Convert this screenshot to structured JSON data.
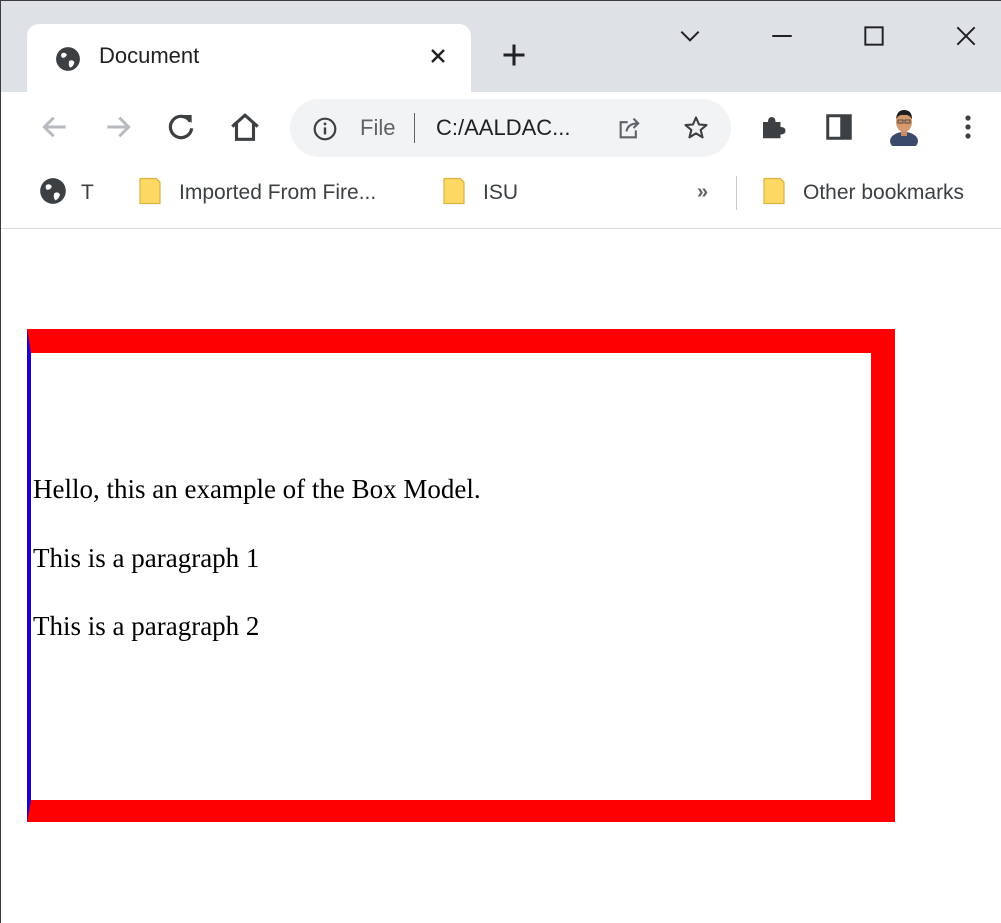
{
  "browser": {
    "tab": {
      "title": "Document"
    },
    "new_tab_label": "+",
    "address_bar": {
      "scheme": "File",
      "url": "C:/AALDAC..."
    },
    "bookmarks": [
      {
        "label": "T",
        "icon": "globe-icon"
      },
      {
        "label": "Imported From Fire...",
        "icon": "folder-icon"
      },
      {
        "label": "ISU",
        "icon": "folder-icon"
      }
    ],
    "overflow_label": "»",
    "other_bookmarks": {
      "label": "Other bookmarks",
      "icon": "folder-icon"
    }
  },
  "page": {
    "heading_text": "Hello, this an example of the Box Model.",
    "paragraphs": [
      "This is a paragraph 1",
      "This is a paragraph 2"
    ]
  },
  "colors": {
    "tabstrip": "#dee1e6",
    "box_border": "#ff0000",
    "box_left_border": "#1e00c8",
    "folder": "#fcd864"
  }
}
